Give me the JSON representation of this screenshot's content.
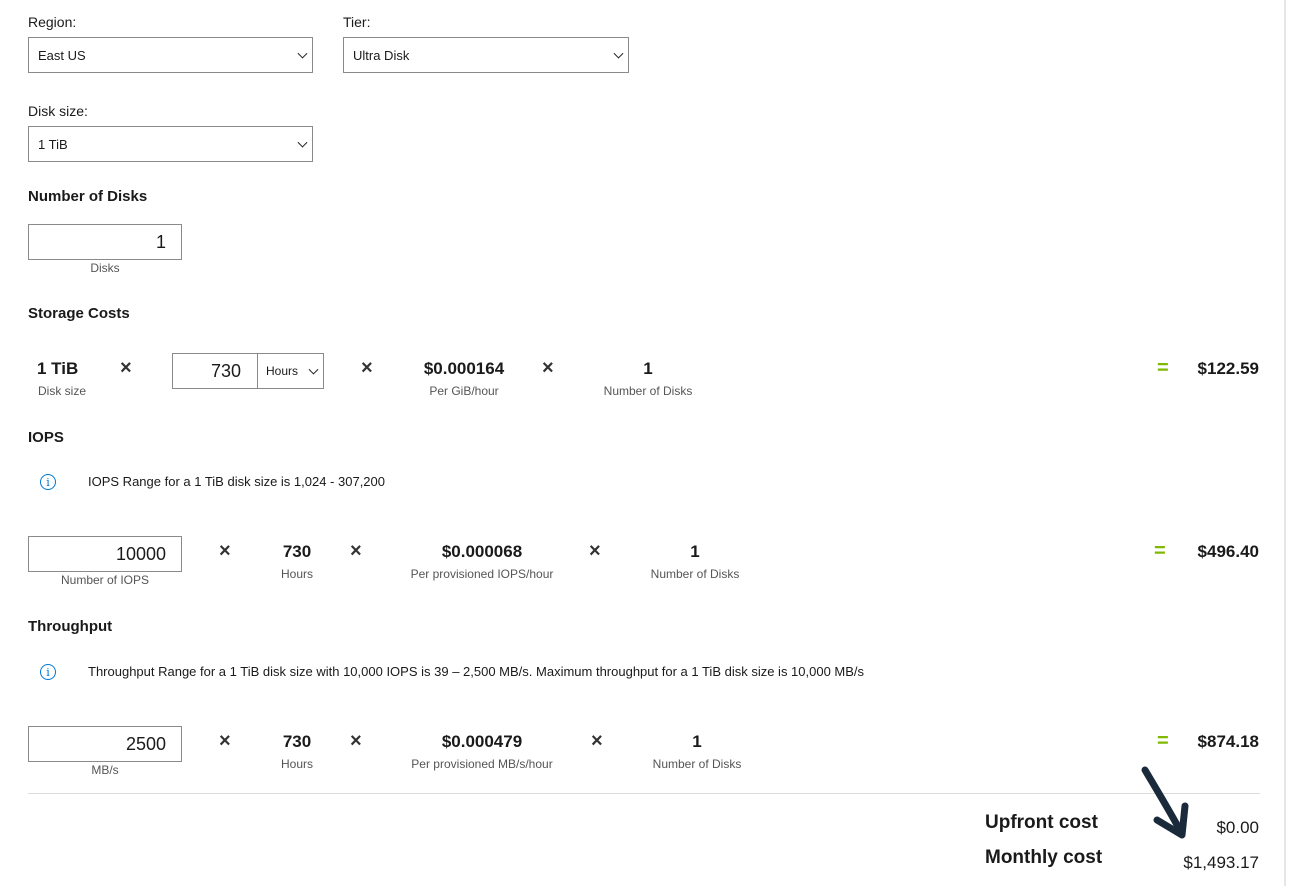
{
  "region": {
    "label": "Region:",
    "value": "East US"
  },
  "tier": {
    "label": "Tier:",
    "value": "Ultra Disk"
  },
  "disk_size": {
    "label": "Disk size:",
    "value": "1 TiB"
  },
  "num_disks": {
    "title": "Number of Disks",
    "value": "1",
    "unit": "Disks"
  },
  "storage": {
    "title": "Storage Costs",
    "size_value": "1 TiB",
    "size_label": "Disk size",
    "hours_value": "730",
    "hours_unit": "Hours",
    "rate_value": "$0.000164",
    "rate_label": "Per GiB/hour",
    "disks_value": "1",
    "disks_label": "Number of Disks",
    "result": "$122.59"
  },
  "iops": {
    "title": "IOPS",
    "info": "IOPS Range for a 1 TiB disk size is 1,024 - 307,200",
    "value": "10000",
    "value_label": "Number of IOPS",
    "hours_value": "730",
    "hours_label": "Hours",
    "rate_value": "$0.000068",
    "rate_label": "Per provisioned IOPS/hour",
    "disks_value": "1",
    "disks_label": "Number of Disks",
    "result": "$496.40"
  },
  "throughput": {
    "title": "Throughput",
    "info": "Throughput Range for a 1 TiB disk size with 10,000 IOPS is 39 – 2,500 MB/s. Maximum throughput for a 1 TiB disk size is 10,000 MB/s",
    "value": "2500",
    "value_label": "MB/s",
    "hours_value": "730",
    "hours_label": "Hours",
    "rate_value": "$0.000479",
    "rate_label": "Per provisioned MB/s/hour",
    "disks_value": "1",
    "disks_label": "Number of Disks",
    "result": "$874.18"
  },
  "summary": {
    "upfront_label": "Upfront cost",
    "upfront_value": "$0.00",
    "monthly_label": "Monthly cost",
    "monthly_value": "$1,493.17"
  },
  "symbols": {
    "times": "×",
    "equals": "=",
    "info": "i"
  },
  "colors": {
    "accent_green": "#7fba00",
    "info_blue": "#0078d4",
    "arrow": "#1b2a3a"
  }
}
